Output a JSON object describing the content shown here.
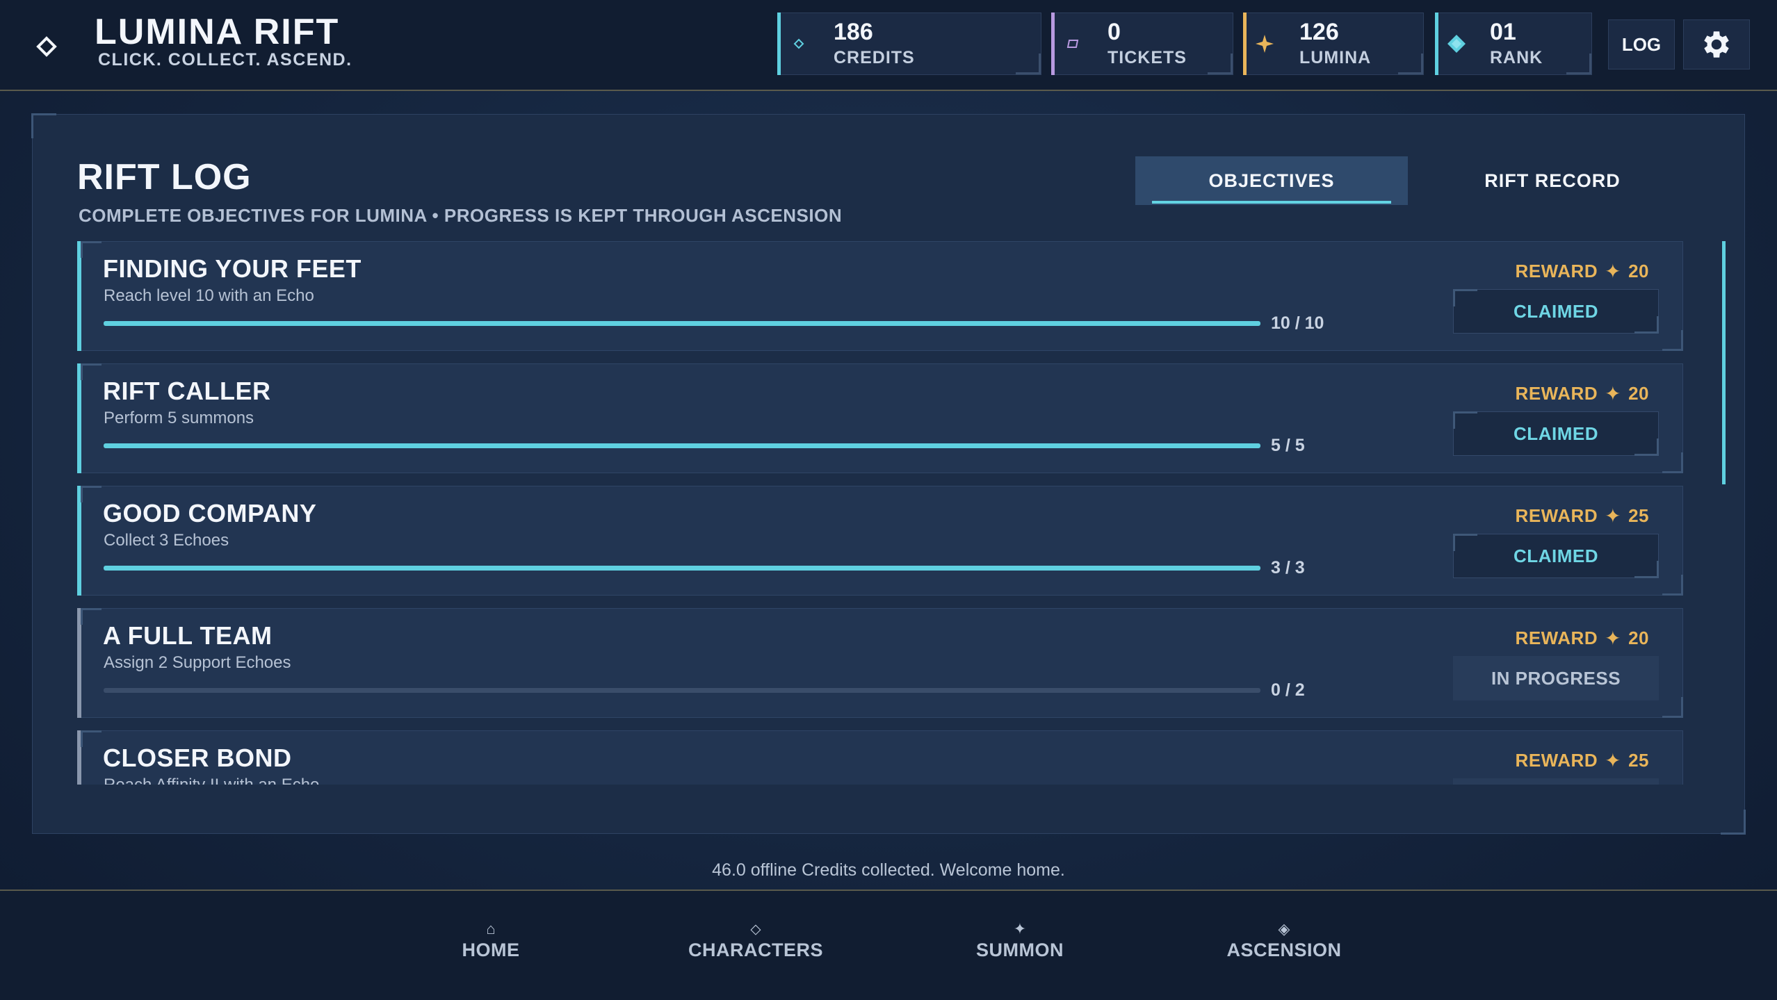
{
  "brand": {
    "title": "LUMINA RIFT",
    "tagline": "CLICK. COLLECT. ASCEND.",
    "icon": "diamond-outline-icon"
  },
  "stats": [
    {
      "value": "186",
      "label": "CREDITS",
      "icon": "credits-diamond-icon",
      "color": "#5fd0e0"
    },
    {
      "value": "0",
      "label": "TICKETS",
      "icon": "ticket-icon",
      "color": "#b89ae0"
    },
    {
      "value": "126",
      "label": "LUMINA",
      "icon": "sparkle-icon",
      "color": "#e9b55a"
    },
    {
      "value": "01",
      "label": "RANK",
      "icon": "rank-diamond-icon",
      "color": "#5fd0e0"
    }
  ],
  "header_buttons": {
    "log_label": "LOG",
    "settings_icon": "gear-icon"
  },
  "panel": {
    "title": "RIFT LOG",
    "subtitle": "COMPLETE OBJECTIVES FOR LUMINA • PROGRESS IS KEPT THROUGH ASCENSION",
    "tabs": [
      {
        "label": "OBJECTIVES",
        "active": true
      },
      {
        "label": "RIFT RECORD",
        "active": false
      }
    ]
  },
  "objectives": [
    {
      "name": "FINDING YOUR FEET",
      "desc": "Reach level 10 with an Echo",
      "progress_text": "10 / 10",
      "progress": 1.0,
      "reward_label": "REWARD",
      "reward_icon": "✦",
      "reward_value": "20",
      "status": "CLAIMED",
      "claimed": true
    },
    {
      "name": "RIFT CALLER",
      "desc": "Perform 5 summons",
      "progress_text": "5 / 5",
      "progress": 1.0,
      "reward_label": "REWARD",
      "reward_icon": "✦",
      "reward_value": "20",
      "status": "CLAIMED",
      "claimed": true
    },
    {
      "name": "GOOD COMPANY",
      "desc": "Collect 3 Echoes",
      "progress_text": "3 / 3",
      "progress": 1.0,
      "reward_label": "REWARD",
      "reward_icon": "✦",
      "reward_value": "25",
      "status": "CLAIMED",
      "claimed": true
    },
    {
      "name": "A FULL TEAM",
      "desc": "Assign 2 Support Echoes",
      "progress_text": "0 / 2",
      "progress": 0.0,
      "reward_label": "REWARD",
      "reward_icon": "✦",
      "reward_value": "20",
      "status": "IN PROGRESS",
      "claimed": false
    },
    {
      "name": "CLOSER BOND",
      "desc": "Reach Affinity II with an Echo",
      "progress_text": "",
      "progress": 0.0,
      "reward_label": "REWARD",
      "reward_icon": "✦",
      "reward_value": "25",
      "status": "",
      "claimed": false
    }
  ],
  "notice": "46.0 offline Credits collected. Welcome home.",
  "bottom_nav": [
    {
      "label": "HOME",
      "icon": "⌂",
      "icon_name": "home-icon"
    },
    {
      "label": "CHARACTERS",
      "icon": "⬦",
      "icon_name": "characters-icon"
    },
    {
      "label": "SUMMON",
      "icon": "✦",
      "icon_name": "summon-icon"
    },
    {
      "label": "ASCENSION",
      "icon": "◈",
      "icon_name": "ascension-icon"
    }
  ],
  "colors": {
    "accent": "#5fd0e0",
    "gold": "#e9b55a",
    "background": "#14223a"
  }
}
